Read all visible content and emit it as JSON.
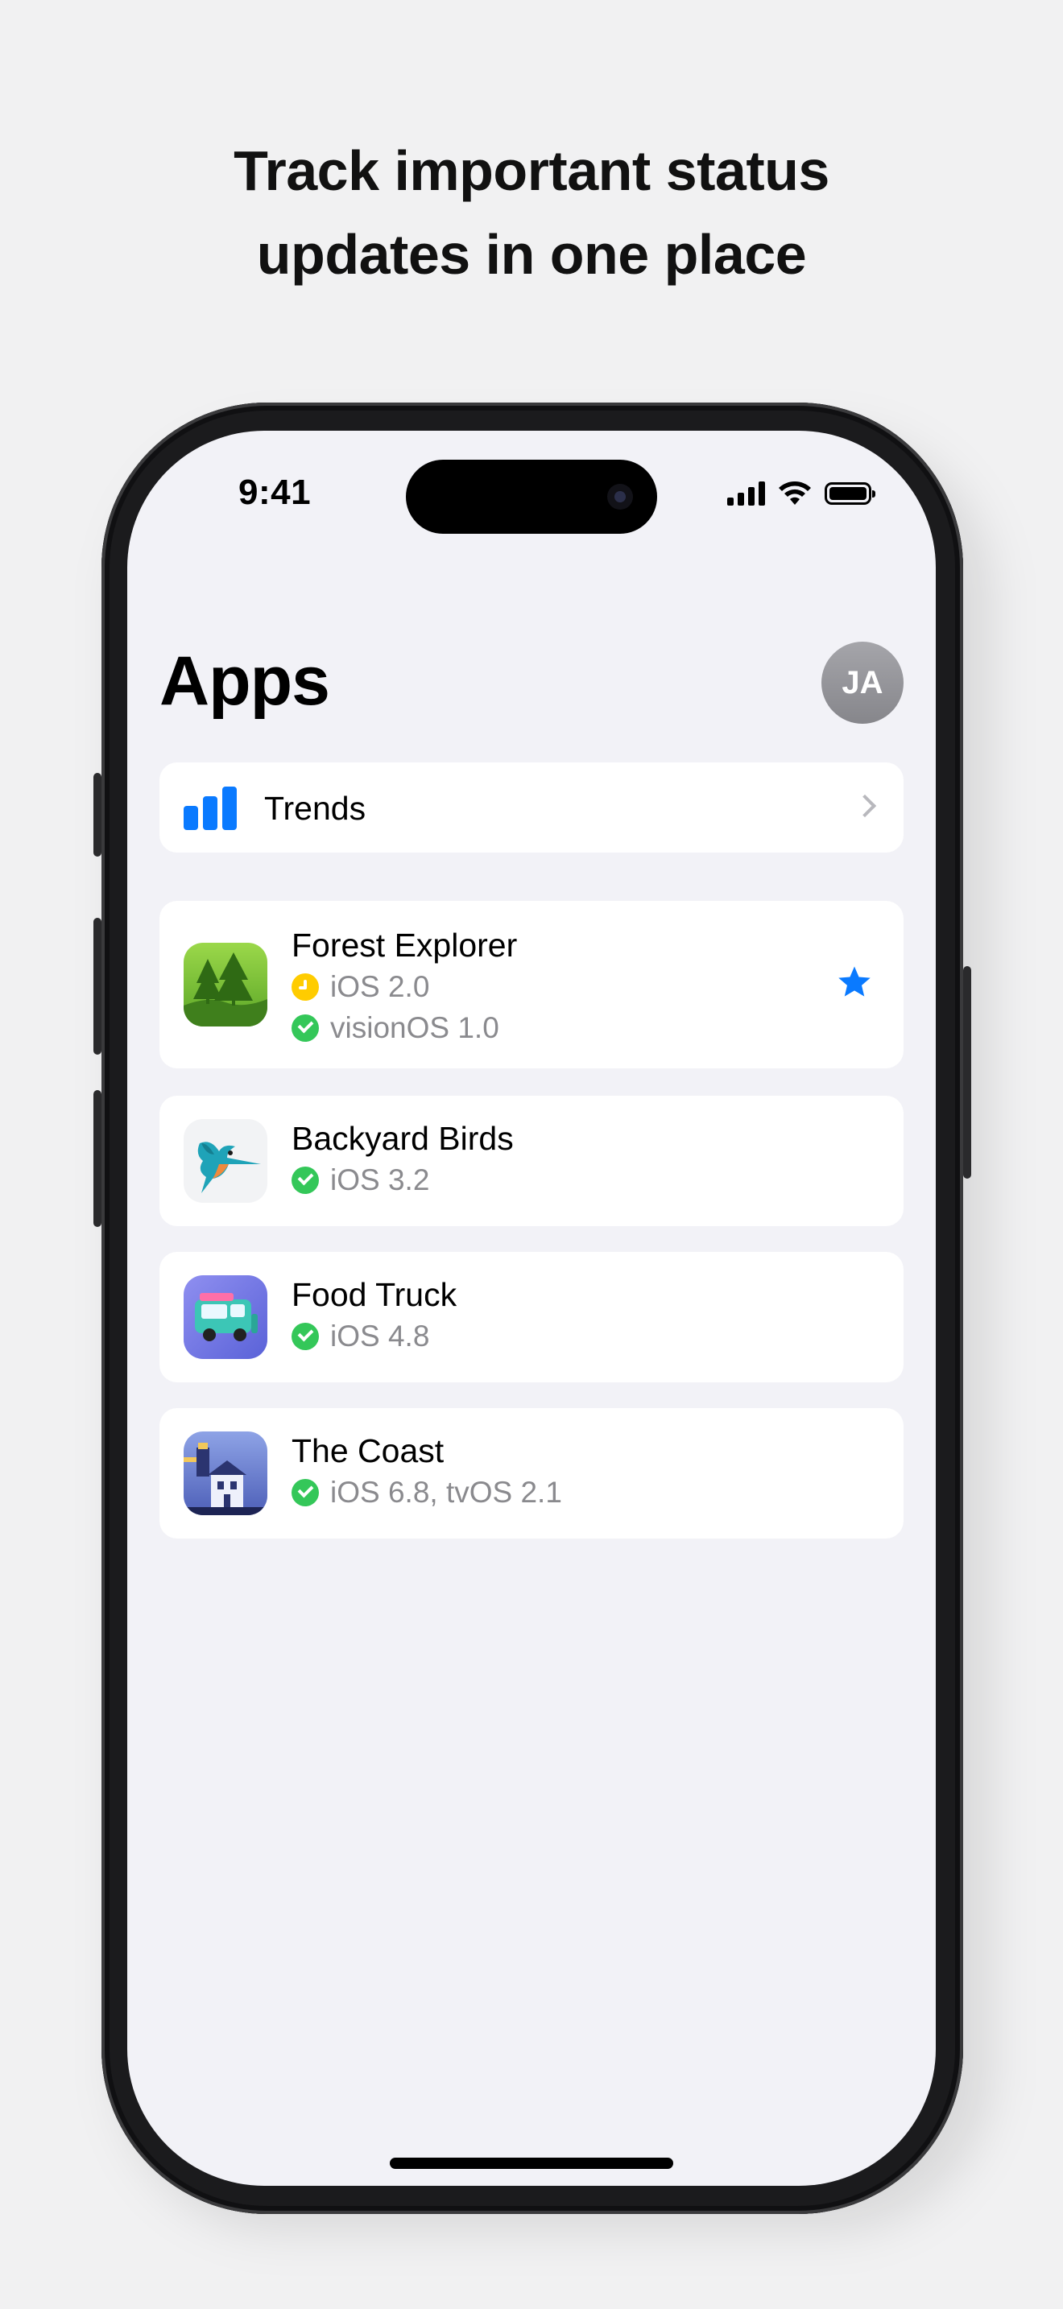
{
  "headline": {
    "line1": "Track important status",
    "line2": "updates in one place"
  },
  "status_bar": {
    "time": "9:41",
    "icons": [
      "cellular-signal-icon",
      "wifi-icon",
      "battery-icon"
    ]
  },
  "nav": {
    "title": "Apps",
    "avatar_initials": "JA"
  },
  "trends_row": {
    "label": "Trends",
    "icon": "bar-chart-icon",
    "accent": "#0A7AFF"
  },
  "apps": [
    {
      "name": "Forest Explorer",
      "icon": "forest-explorer-app-icon",
      "statuses": [
        {
          "state": "pending",
          "text": "iOS 2.0"
        },
        {
          "state": "approved",
          "text": "visionOS 1.0"
        }
      ],
      "favorite": true
    },
    {
      "name": "Backyard Birds",
      "icon": "backyard-birds-app-icon",
      "statuses": [
        {
          "state": "approved",
          "text": "iOS 3.2"
        }
      ]
    },
    {
      "name": "Food Truck",
      "icon": "food-truck-app-icon",
      "statuses": [
        {
          "state": "approved",
          "text": "iOS 4.8"
        }
      ]
    },
    {
      "name": "The Coast",
      "icon": "the-coast-app-icon",
      "statuses": [
        {
          "state": "approved",
          "text": "iOS 6.8, tvOS 2.1"
        }
      ]
    }
  ],
  "colors": {
    "approved": "#34C759",
    "pending": "#FFCC00",
    "favorite": "#0A7AFF",
    "background": "#F2F2F7"
  }
}
